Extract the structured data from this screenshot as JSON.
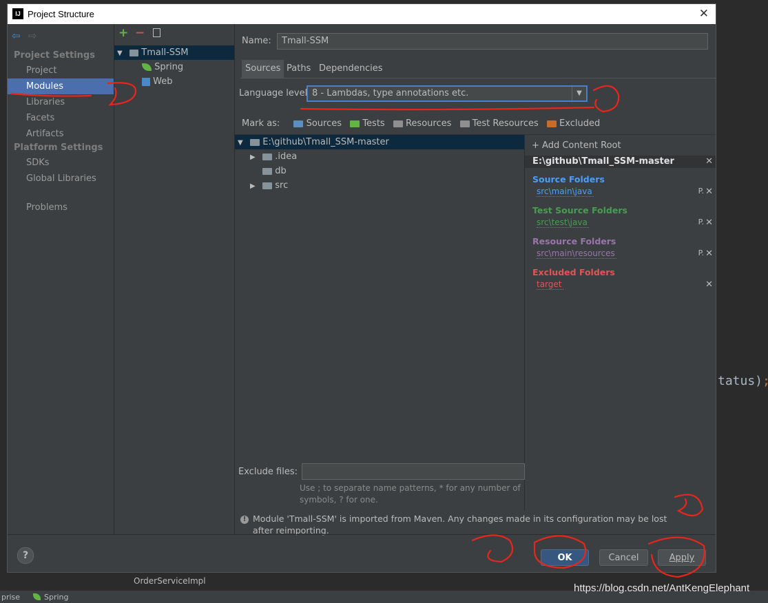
{
  "dialog": {
    "title": "Project Structure"
  },
  "nav": {
    "project_settings_header": "Project Settings",
    "platform_settings_header": "Platform Settings",
    "items": [
      {
        "label": "Project"
      },
      {
        "label": "Modules"
      },
      {
        "label": "Libraries"
      },
      {
        "label": "Facets"
      },
      {
        "label": "Artifacts"
      },
      {
        "label": "SDKs"
      },
      {
        "label": "Global Libraries"
      },
      {
        "label": "Problems"
      }
    ],
    "selected": "Modules"
  },
  "modules": {
    "tree": [
      {
        "label": "Tmall-SSM"
      },
      {
        "label": "Spring"
      },
      {
        "label": "Web"
      }
    ]
  },
  "module": {
    "name_label": "Name:",
    "name_value": "Tmall-SSM",
    "tabs": [
      {
        "label": "Sources"
      },
      {
        "label": "Paths"
      },
      {
        "label": "Dependencies"
      }
    ],
    "active_tab": "Sources",
    "language_level_label": "Language level:",
    "language_level_value": "8 - Lambdas, type annotations etc.",
    "mark_as_label": "Mark as:",
    "mark_as": [
      {
        "label": "Sources",
        "color": "#5b8ec1"
      },
      {
        "label": "Tests",
        "color": "#62b543"
      },
      {
        "label": "Resources",
        "color": "#8f8f8f"
      },
      {
        "label": "Test Resources",
        "color": "#8f8f8f"
      },
      {
        "label": "Excluded",
        "color": "#c86c2a"
      }
    ],
    "file_tree": [
      {
        "label": "E:\\github\\Tmall_SSM-master"
      },
      {
        "label": ".idea"
      },
      {
        "label": "db"
      },
      {
        "label": "src"
      }
    ],
    "add_content_root": "+ Add Content Root",
    "content_root": "E:\\github\\Tmall_SSM-master",
    "groups": {
      "source": {
        "title": "Source Folders",
        "path": "src\\main\\java",
        "color": "#4a9eff"
      },
      "test": {
        "title": "Test Source Folders",
        "path": "src\\test\\java",
        "color": "#499c54"
      },
      "resource": {
        "title": "Resource Folders",
        "path": "src\\main\\resources",
        "color": "#9876aa"
      },
      "excluded": {
        "title": "Excluded Folders",
        "path": "target",
        "color": "#e05555"
      }
    },
    "exclude_files_label": "Exclude files:",
    "exclude_files_value": "",
    "exclude_hint": "Use ; to separate name patterns, * for any number of symbols, ? for one.",
    "warning": "Module 'Tmall-SSM' is imported from Maven. Any changes made in its configuration may be lost after reimporting."
  },
  "buttons": {
    "help": "?",
    "ok": "OK",
    "cancel": "Cancel",
    "apply": "Apply"
  },
  "background": {
    "code_fragment": "tatus)",
    "code_semicolon": ";",
    "file_label": "OrderServiceImpl",
    "status_left": "prise",
    "status_spring": "Spring",
    "watermark": "https://blog.csdn.net/AntKengElephant"
  },
  "annotations": [
    "1",
    "2",
    "3",
    "4"
  ]
}
